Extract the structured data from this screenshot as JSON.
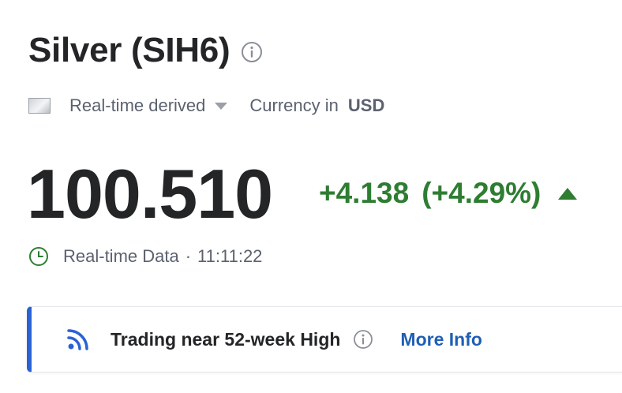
{
  "header": {
    "title": "Silver (SIH6)"
  },
  "meta": {
    "data_type_label": "Real-time derived",
    "currency_label": "Currency in",
    "currency_value": "USD"
  },
  "quote": {
    "price": "100.510",
    "change": "+4.138",
    "change_percent": "(+4.29%)",
    "direction": "up",
    "change_color": "#2e7d32"
  },
  "status": {
    "label": "Real-time Data",
    "separator": "·",
    "time": "11:11:22"
  },
  "banner": {
    "text": "Trading near 52-week High",
    "link_label": "More Info",
    "accent_color": "#2a62d4",
    "icon": "rss-signal-icon"
  }
}
